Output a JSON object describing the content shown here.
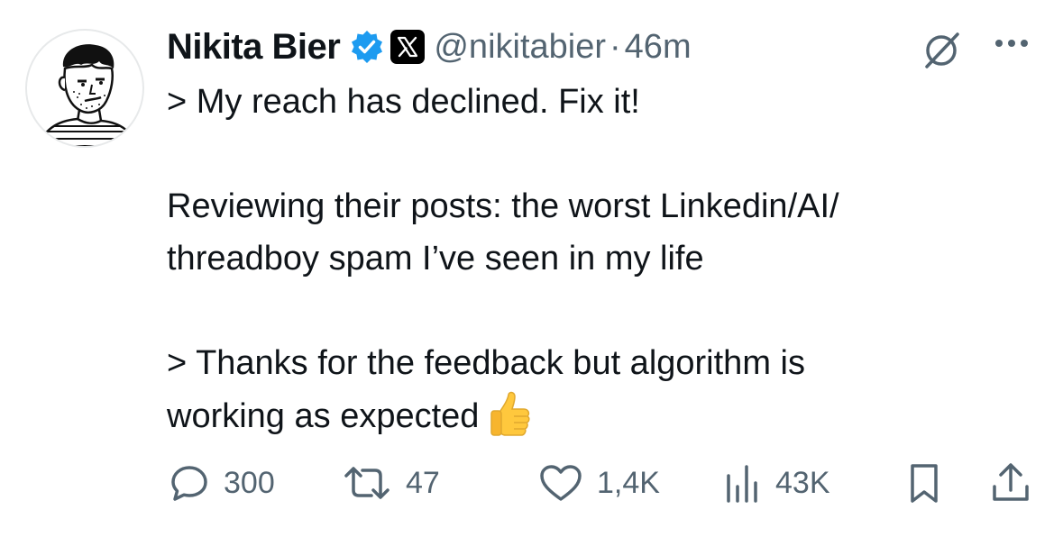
{
  "author": {
    "name": "Nikita Bier",
    "handle": "@nikitabier",
    "separator": "·",
    "time": "46m"
  },
  "tweet": {
    "text": "> My reach has declined. Fix it!\n\nReviewing their posts: the worst Linkedin/AI/\nthreadboy spam I’ve seen in my life\n\n> Thanks for the feedback but algorithm is\nworking as expected",
    "emoji": "thumbs-up-emoji"
  },
  "actions": {
    "replies": "300",
    "reposts": "47",
    "likes": "1,4K",
    "views": "43K"
  },
  "icons": [
    "verified-badge-icon",
    "x-affiliate-icon",
    "grok-icon",
    "more-icon",
    "reply-icon",
    "repost-icon",
    "like-icon",
    "views-icon",
    "bookmark-icon",
    "share-icon"
  ],
  "colors": {
    "text": "#0f1419",
    "secondary": "#536471",
    "verified": "#1d9bf0"
  }
}
